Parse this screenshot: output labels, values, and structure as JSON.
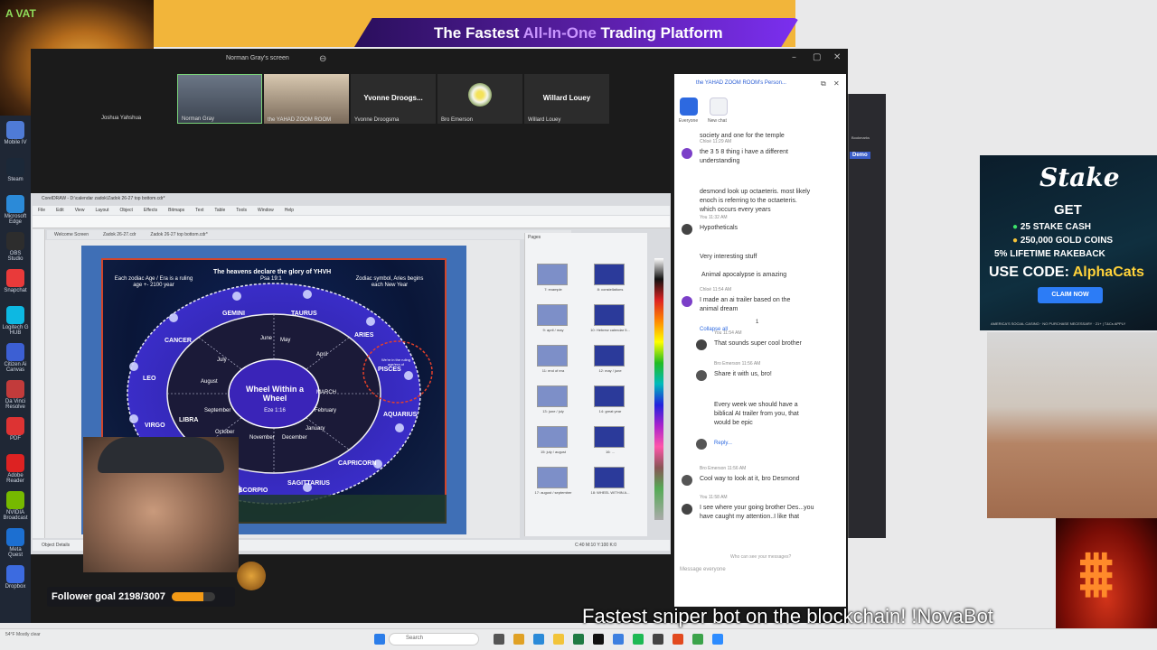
{
  "banner": {
    "pre": "The Fastest ",
    "highlight": "All-In-One",
    "post": " Trading Platform"
  },
  "lion_watermark": "A VAT",
  "left_dock": [
    {
      "label": "Mobile IV",
      "color": "#4f7bd6"
    },
    {
      "label": "Steam",
      "color": "#1b2838"
    },
    {
      "label": "Microsoft Edge",
      "color": "#2b8ad8"
    },
    {
      "label": "OBS Studio",
      "color": "#2d2d2d"
    },
    {
      "label": "Snapchat",
      "color": "#e93a3a"
    },
    {
      "label": "Logitech G HUB",
      "color": "#0db8e2"
    },
    {
      "label": "Citizen Ai Canvas",
      "color": "#3c5fd3"
    },
    {
      "label": "Da Vinci Resolve",
      "color": "#c23b3b"
    },
    {
      "label": "PDF",
      "color": "#d33"
    },
    {
      "label": "Adobe Reader",
      "color": "#d22"
    },
    {
      "label": "NVIDIA Broadcast",
      "color": "#76b900"
    },
    {
      "label": "Meta Quest",
      "color": "#1c6fd1"
    },
    {
      "label": "Dropbox",
      "color": "#3c6be0"
    }
  ],
  "zoom": {
    "share_title": "Norman Gray's screen",
    "participants": [
      {
        "name": "Norman Gray",
        "kind": "video"
      },
      {
        "name": "the YAHAD ZOOM ROOM",
        "kind": "video"
      },
      {
        "name": "Yvonne Droogsma",
        "big": "Yvonne Droogs...",
        "kind": "name"
      },
      {
        "name": "Bro Emerson",
        "kind": "flower"
      },
      {
        "name": "Willard Louey",
        "big": "Willard Louey",
        "kind": "name"
      }
    ],
    "top_left_tile": "Joshua Yahshua"
  },
  "corel": {
    "title": "CorelDRAW - D:\\calendar zadok\\Zadok 26-27 top bottom.cdr*",
    "menu": [
      "File",
      "Edit",
      "View",
      "Layout",
      "Object",
      "Effects",
      "Bitmaps",
      "Text",
      "Table",
      "Tools",
      "Window",
      "Help"
    ],
    "tabs": [
      "Welcome Screen",
      "Zadok 26-27.cdr",
      "Zadok 26-27 top bottom.cdr*"
    ],
    "status": "Object Details",
    "color_readout": "C:40 M:10 Y:100 K:0",
    "artwork": {
      "heading": "The heavens declare the glory of YHVH",
      "subheading": "Psa 19:1",
      "left_note": "Each zodiac Age / Era is a ruling age +- 2100 year",
      "right_note": "Zodiac symbol, Aries begins each New Year",
      "center_title": "Wheel Within a Wheel",
      "center_ref": "Eze 1:16",
      "ruling_note": "We're in the ruling age/era of",
      "signs": [
        "GEMINI",
        "TAURUS",
        "ARIES",
        "PISCES",
        "AQUARIUS",
        "CAPRICORN",
        "SAGITTARIUS",
        "SCORPIO",
        "LIBRA",
        "VIRGO",
        "LEO",
        "CANCER"
      ],
      "months": [
        "May",
        "April",
        "June",
        "July",
        "August",
        "September",
        "October",
        "November",
        "December",
        "January",
        "February",
        "MARCH"
      ],
      "inner_signs": [
        "GEMINI",
        "TAURUS",
        "CANCER",
        "LEO",
        "VIRGO",
        "LIBRA",
        "SCORPIO",
        "SAGITTARIUS",
        "CAPRICORN",
        "AQUARIUS",
        "PISCES",
        "ARIES"
      ]
    },
    "pages": [
      {
        "left": "7: example",
        "right": "8: constellations"
      },
      {
        "left": "9: april / may",
        "right": "10: Hebrew calendar 5..."
      },
      {
        "left": "11: end of era",
        "right": "12: may / june"
      },
      {
        "left": "13: june / july",
        "right": "14: great year"
      },
      {
        "left": "15: july / august",
        "right": "16: ..."
      },
      {
        "left": "17: august / september",
        "right": "18: WHEEL WITHIN A..."
      }
    ],
    "pages_header": "Pages"
  },
  "chat": {
    "header": "the YAHAD ZOOM ROOM's Person...",
    "tabs": [
      {
        "label": "Everyone"
      },
      {
        "label": "New chat"
      }
    ],
    "messages": [
      {
        "meta": "",
        "text": "society and one for the temple"
      },
      {
        "meta": "Chloé 11:29 AM",
        "text": "the 3 5 8 thing i have a different understanding"
      },
      {
        "meta": "",
        "text": "desmond look up octaeteris. most likely enoch is referring to the octaeteris. which occurs every years"
      },
      {
        "meta": "You 11:32 AM",
        "text": "Hypotheticals"
      },
      {
        "meta": "",
        "text": "Very interesting stuff"
      },
      {
        "meta": "",
        "text": "Animal apocalypse is amazing"
      },
      {
        "meta": "Chloé 11:54 AM",
        "text": "I made an ai trailer based on the animal dream"
      },
      {
        "meta": "",
        "text": "Collapse all"
      },
      {
        "meta": "You 11:54 AM",
        "text": "That sounds super cool brother"
      },
      {
        "meta": "Bro Emerson 11:56 AM",
        "text": "Share it with us, bro!"
      },
      {
        "meta": "",
        "text": "Every week we should have a biblical AI trailer from you, that would be epic"
      },
      {
        "meta": "",
        "text": "Reply..."
      },
      {
        "meta": "Bro Emerson 11:56 AM",
        "text": "Cool way to look at it, bro Desmond"
      },
      {
        "meta": "You 11:58 AM",
        "text": "I see where your going brother Des...you have caught my attention..I like that"
      }
    ],
    "reaction": "1",
    "who_sees": "Who can see your messages?",
    "input_placeholder": "Message everyone"
  },
  "side_panel": {
    "demo": "Demo",
    "bookmarks": "Bookmarks"
  },
  "stake_ad": {
    "logo": "Stake",
    "get": "GET",
    "line1": "25 STAKE CASH",
    "line2": "250,000 GOLD COINS",
    "line3": "5% LIFETIME RAKEBACK",
    "code_label": "USE CODE: ",
    "code": "AlphaCats",
    "button": "CLAIM NOW",
    "footer": "AMERICA'S SOCIAL CASINO · NO PURCHASE NECESSARY · 21+ | T&Cs APPLY"
  },
  "follower_goal": {
    "label": "Follower goal 2198/3007",
    "current": 2198,
    "target": 3007
  },
  "ticker": "Fastest sniper bot on the blockchain! !NovaBot",
  "taskbar": {
    "search_placeholder": "Search",
    "weather": "54°F Mostly clear",
    "icons": [
      {
        "name": "start",
        "color": "#2b7de9"
      },
      {
        "name": "task-view",
        "color": "#555"
      },
      {
        "name": "chrome",
        "color": "#e0a125"
      },
      {
        "name": "edge",
        "color": "#2b8ad8"
      },
      {
        "name": "explorer",
        "color": "#f2c43a"
      },
      {
        "name": "excel",
        "color": "#1f7a43"
      },
      {
        "name": "x",
        "color": "#111"
      },
      {
        "name": "store",
        "color": "#3c7fe0"
      },
      {
        "name": "spotify",
        "color": "#1db954"
      },
      {
        "name": "obs",
        "color": "#444"
      },
      {
        "name": "brave",
        "color": "#e24a1f"
      },
      {
        "name": "corel",
        "color": "#3ba34a"
      },
      {
        "name": "zoom",
        "color": "#2d8cff"
      }
    ]
  }
}
